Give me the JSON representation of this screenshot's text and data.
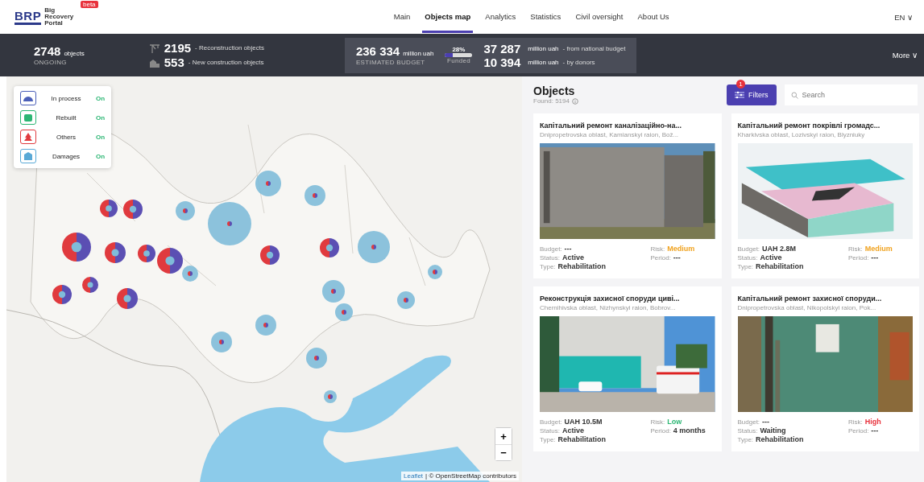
{
  "header": {
    "logo": {
      "mark": "BRP",
      "name": "Big Recovery Portal",
      "badge": "beta"
    },
    "nav": [
      {
        "label": "Main",
        "selected": false
      },
      {
        "label": "Objects map",
        "selected": true
      },
      {
        "label": "Analytics",
        "selected": false
      },
      {
        "label": "Statistics",
        "selected": false
      },
      {
        "label": "Civil oversight",
        "selected": false
      },
      {
        "label": "About Us",
        "selected": false
      }
    ],
    "language": "EN ∨"
  },
  "stats": {
    "ongoing": {
      "value": "2748",
      "unit": "objects",
      "caption": "ONGOING"
    },
    "reconstruction": {
      "value": "2195",
      "caption": "- Reconstruction objects"
    },
    "new_construction": {
      "value": "553",
      "caption": "- New construction objects"
    },
    "budget": {
      "value": "236 334",
      "unit": "million uah",
      "caption": "ESTIMATED BUDGET"
    },
    "funded": {
      "percent": "28%",
      "caption": "Funded",
      "level": 0.28
    },
    "national": {
      "value": "37 287",
      "unit": "million uah",
      "caption": "- from national budget"
    },
    "donors": {
      "value": "10 394",
      "unit": "million uah",
      "caption": "- by donors"
    },
    "more": "More ∨"
  },
  "map": {
    "legend": [
      {
        "kind": "in_process",
        "label": "In process",
        "status": "On",
        "on": true
      },
      {
        "kind": "rebuilt",
        "label": "Rebuilt",
        "status": "On",
        "on": true
      },
      {
        "kind": "others",
        "label": "Others",
        "status": "On",
        "on": true
      },
      {
        "kind": "damages",
        "label": "Damages",
        "status": "On",
        "on": true
      }
    ],
    "zoom_in": "+",
    "zoom_out": "−",
    "attribution": {
      "leaflet": "Leaflet",
      "rest": "| © OpenStreetMap contributors"
    }
  },
  "objects": {
    "title": "Objects",
    "found": "Found: 5194",
    "filters": {
      "label": "Filters",
      "badge": "1"
    },
    "search": {
      "placeholder": "Search"
    },
    "cards": [
      {
        "title": "Капітальний ремонт каналізаційно-на...",
        "location": "Dnipropetrovska oblast, Kamianskyi raion, Bož...",
        "budget_label": "Budget:",
        "budget": "---",
        "risk_label": "Risk:",
        "risk": {
          "text": "Medium",
          "color": "#f0a21e"
        },
        "status_label": "Status:",
        "status": "Active",
        "period_label": "Period:",
        "period": "---",
        "type_label": "Type:",
        "type": "Rehabilitation"
      },
      {
        "title": "Капітальний ремонт покрівлі громадс...",
        "location": "Kharkivska oblast, Lozivskyi raion, Blyzniuky",
        "budget_label": "Budget:",
        "budget": "UAH 2.8M",
        "risk_label": "Risk:",
        "risk": {
          "text": "Medium",
          "color": "#f0a21e"
        },
        "status_label": "Status:",
        "status": "Active",
        "period_label": "Period:",
        "period": "---",
        "type_label": "Type:",
        "type": "Rehabilitation"
      },
      {
        "title": "Реконструкція захисної споруди циві...",
        "location": "Chernihivska oblast, Nizhynskyi raion, Bobrov...",
        "budget_label": "Budget:",
        "budget": "UAH 10.5M",
        "risk_label": "Risk:",
        "risk": {
          "text": "Low",
          "color": "#2bb673"
        },
        "status_label": "Status:",
        "status": "Active",
        "period_label": "Period:",
        "period": "4 months",
        "type_label": "Type:",
        "type": "Rehabilitation"
      },
      {
        "title": "Капітальний ремонт захисної споруди...",
        "location": "Dnipropetrovska oblast, Nikopolskyi raion, Pok...",
        "budget_label": "Budget:",
        "budget": "---",
        "risk_label": "Risk:",
        "risk": {
          "text": "High",
          "color": "#e8323c"
        },
        "status_label": "Status:",
        "status": "Waiting",
        "period_label": "Period:",
        "period": "---",
        "type_label": "Type:",
        "type": "Rehabilitation"
      }
    ]
  }
}
